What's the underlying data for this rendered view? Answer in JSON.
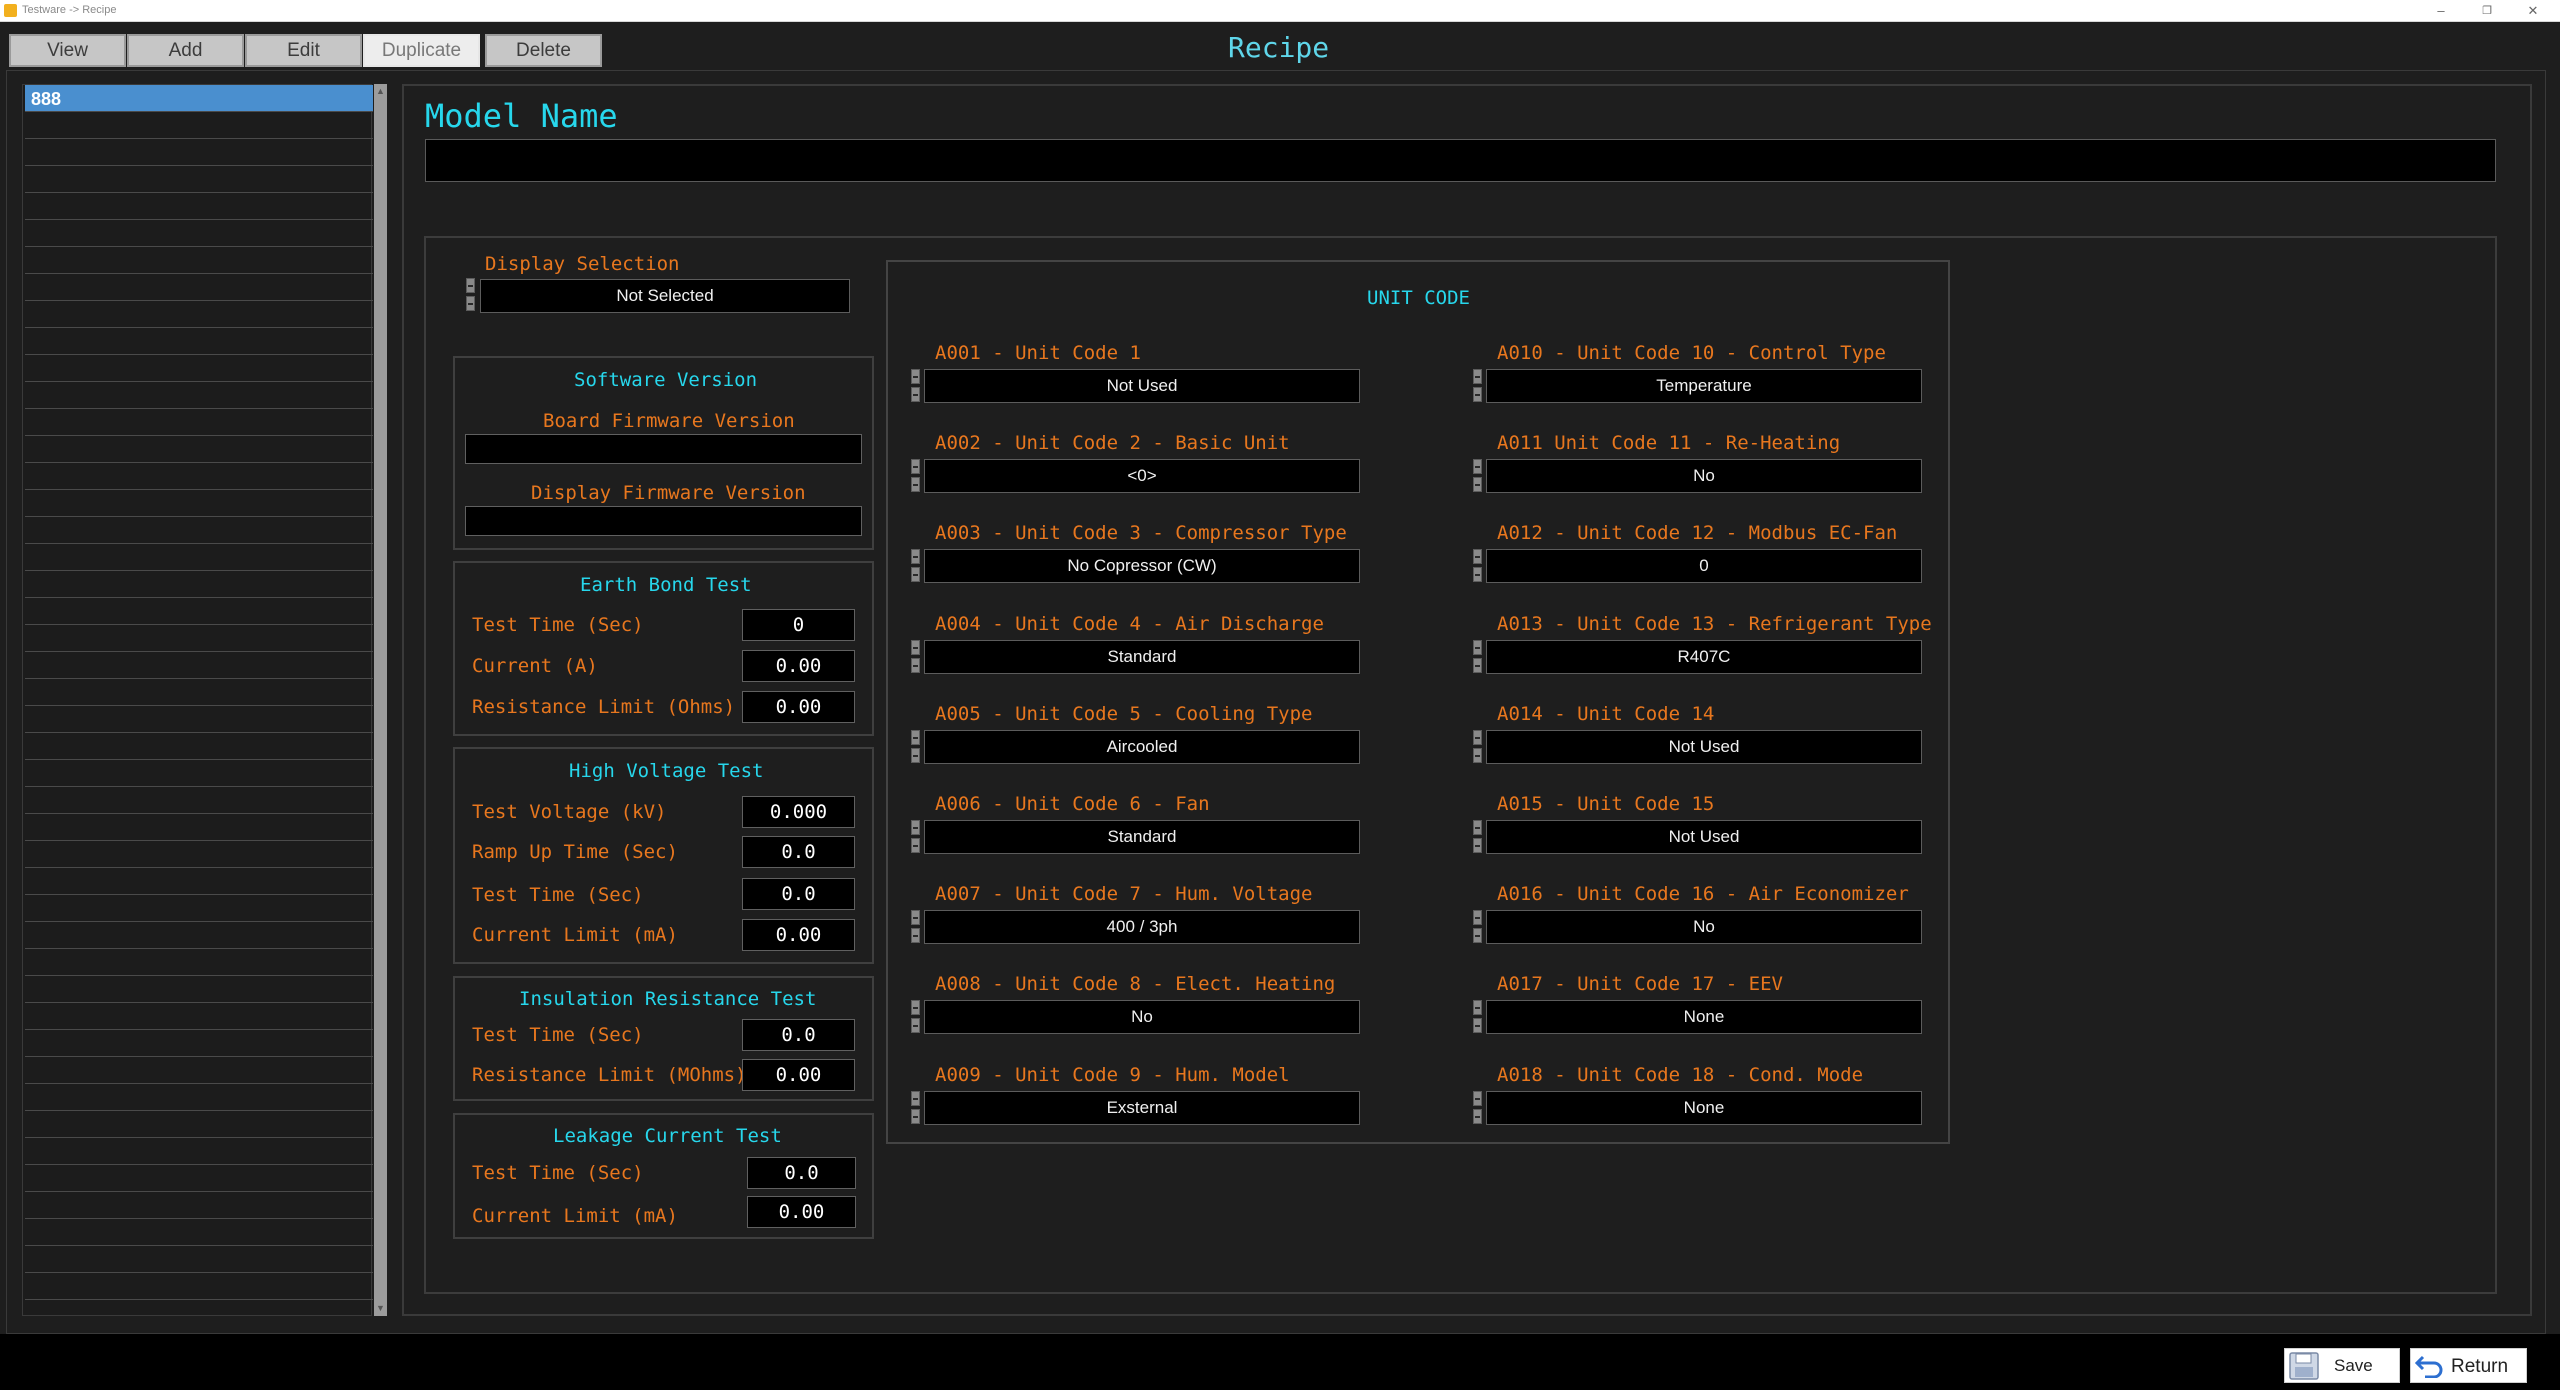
{
  "window": {
    "title": "Testware -> Recipe"
  },
  "toolbar": {
    "view": "View",
    "add": "Add",
    "edit": "Edit",
    "duplicate": "Duplicate",
    "delete": "Delete"
  },
  "header": {
    "title": "Recipe"
  },
  "list": {
    "items": [
      "888"
    ]
  },
  "model": {
    "label": "Model Name",
    "value": ""
  },
  "display_selection": {
    "label": "Display Selection",
    "value": "Not Selected"
  },
  "software": {
    "title": "Software Version",
    "board_label": "Board Firmware Version",
    "board_value": "",
    "display_label": "Display Firmware Version",
    "display_value": ""
  },
  "earth_bond": {
    "title": "Earth Bond Test",
    "fields": [
      {
        "label": "Test Time (Sec)",
        "value": "0"
      },
      {
        "label": "Current (A)",
        "value": "0.00"
      },
      {
        "label": "Resistance Limit (Ohms)",
        "value": "0.00"
      }
    ]
  },
  "high_voltage": {
    "title": "High Voltage Test",
    "fields": [
      {
        "label": "Test Voltage (kV)",
        "value": "0.000"
      },
      {
        "label": "Ramp Up Time (Sec)",
        "value": "0.0"
      },
      {
        "label": "Test Time (Sec)",
        "value": "0.0"
      },
      {
        "label": "Current Limit (mA)",
        "value": "0.00"
      }
    ]
  },
  "insulation": {
    "title": "Insulation Resistance Test",
    "fields": [
      {
        "label": "Test Time (Sec)",
        "value": "0.0"
      },
      {
        "label": "Resistance Limit (MOhms)",
        "value": "0.00"
      }
    ]
  },
  "leakage": {
    "title": "Leakage Current Test",
    "fields": [
      {
        "label": "Test Time (Sec)",
        "value": "0.0"
      },
      {
        "label": "Current Limit (mA)",
        "value": "0.00"
      }
    ]
  },
  "unit_code": {
    "title": "UNIT CODE",
    "left": [
      {
        "label": "A001 - Unit Code 1",
        "value": "Not Used"
      },
      {
        "label": "A002 - Unit Code 2 - Basic Unit",
        "value": "<0>"
      },
      {
        "label": "A003 - Unit Code 3 - Compressor Type",
        "value": "No Copressor (CW)"
      },
      {
        "label": "A004 - Unit Code 4 - Air Discharge",
        "value": "Standard"
      },
      {
        "label": "A005 - Unit Code 5 - Cooling Type",
        "value": "Aircooled"
      },
      {
        "label": "A006 - Unit Code 6 - Fan",
        "value": "Standard"
      },
      {
        "label": "A007 - Unit Code 7 - Hum. Voltage",
        "value": "400 / 3ph"
      },
      {
        "label": "A008 - Unit Code 8 - Elect. Heating",
        "value": "No"
      },
      {
        "label": "A009 - Unit Code 9 - Hum. Model",
        "value": "Exsternal"
      }
    ],
    "right": [
      {
        "label": "A010 - Unit Code 10 - Control Type",
        "value": "Temperature"
      },
      {
        "label": "A011 Unit Code 11 - Re-Heating",
        "value": "No"
      },
      {
        "label": "A012 - Unit Code 12 - Modbus EC-Fan",
        "value": "0"
      },
      {
        "label": "A013 - Unit Code 13 - Refrigerant Type",
        "value": "R407C"
      },
      {
        "label": "A014 - Unit Code 14",
        "value": "Not Used"
      },
      {
        "label": "A015 - Unit Code 15",
        "value": "Not Used"
      },
      {
        "label": "A016 - Unit Code 16 - Air Economizer",
        "value": "No"
      },
      {
        "label": "A017 - Unit Code 17 - EEV",
        "value": "None"
      },
      {
        "label": "A018 - Unit Code 18 - Cond. Mode",
        "value": "None"
      }
    ]
  },
  "footer": {
    "save": "Save",
    "return": "Return"
  },
  "colors": {
    "accent_cyan": "#27d7ec",
    "label_orange": "#e8771e",
    "selected_row": "#4a8fcf",
    "background": "#1e1e1e"
  }
}
